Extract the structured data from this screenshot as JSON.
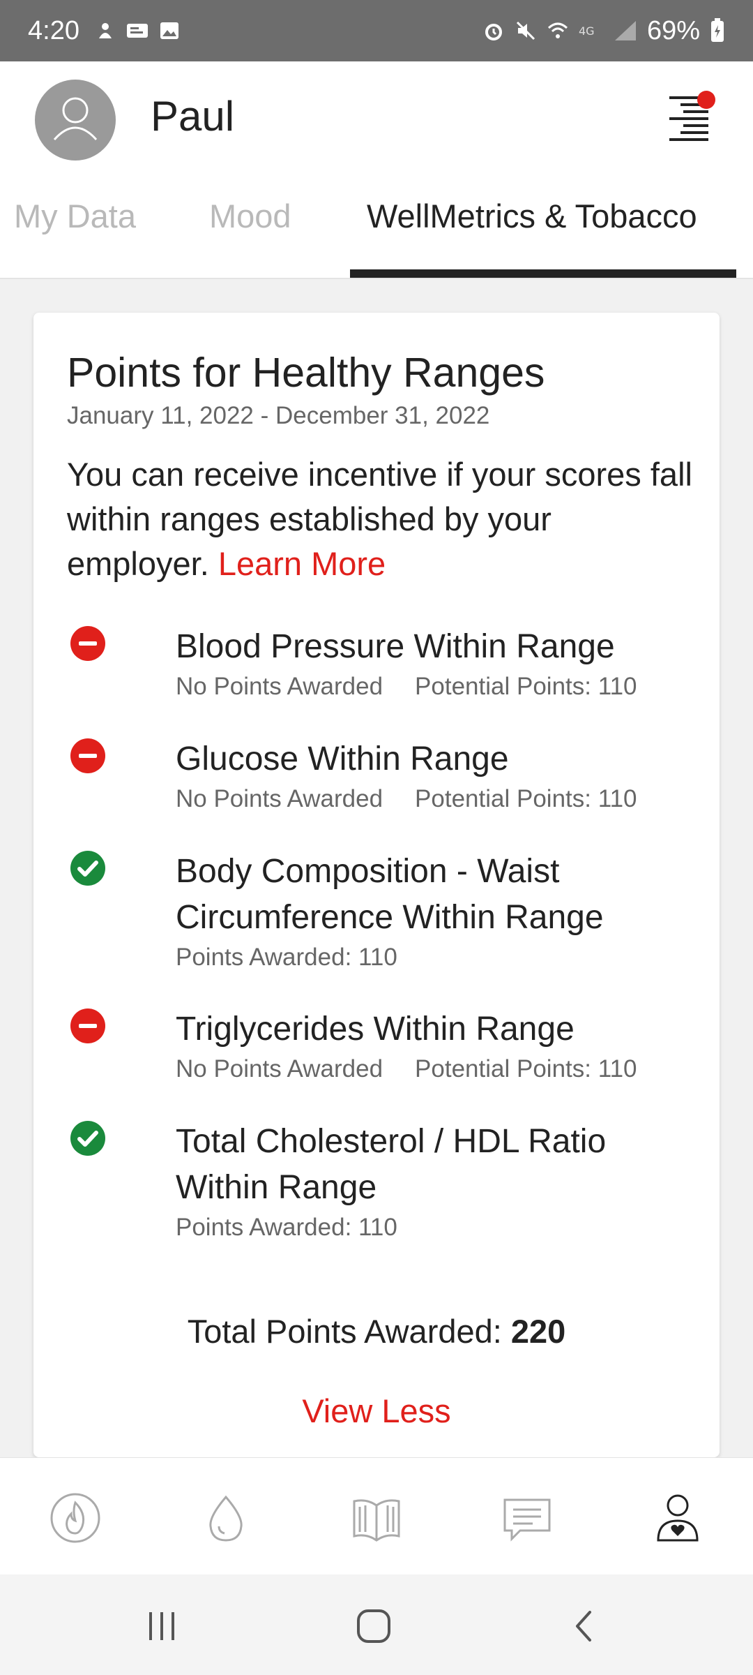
{
  "status_bar": {
    "time": "4:20",
    "left_icons": [
      "notification-icon",
      "message-icon",
      "image-icon"
    ],
    "right_icons": [
      "alarm-icon",
      "mute-icon",
      "wifi-icon",
      "4g-icon",
      "signal-icon"
    ],
    "battery": "69%"
  },
  "header": {
    "username": "Paul",
    "menu_has_notification": true
  },
  "tabs": [
    {
      "label": "My Data",
      "active": false
    },
    {
      "label": "Mood",
      "active": false
    },
    {
      "label": "WellMetrics & Tobacco",
      "active": true
    }
  ],
  "card": {
    "title": "Points for Healthy Ranges",
    "date_range": "January 11, 2022 - December 31, 2022",
    "description": "You can receive incentive if your scores fall within ranges established by your employer.",
    "learn_more": "Learn More",
    "metrics": [
      {
        "title": "Blood Pressure Within Range",
        "status": "not-met",
        "awarded": "No Points Awarded",
        "potential": "Potential Points: 110"
      },
      {
        "title": "Glucose Within Range",
        "status": "not-met",
        "awarded": "No Points Awarded",
        "potential": "Potential Points: 110"
      },
      {
        "title": "Body Composition - Waist Circumference Within Range",
        "status": "met",
        "awarded": "Points Awarded: 110",
        "potential": ""
      },
      {
        "title": "Triglycerides Within Range",
        "status": "not-met",
        "awarded": "No Points Awarded",
        "potential": "Potential Points: 110"
      },
      {
        "title": "Total Cholesterol / HDL Ratio Within Range",
        "status": "met",
        "awarded": "Points Awarded: 110",
        "potential": ""
      }
    ],
    "total_label": "Total Points Awarded:",
    "total_value": "220",
    "view_less": "View Less"
  },
  "bottom_nav": [
    "flame-icon",
    "droplet-icon",
    "book-icon",
    "chat-icon",
    "profile-heart-icon"
  ],
  "system_nav": [
    "recent-apps-icon",
    "home-icon",
    "back-icon"
  ],
  "colors": {
    "accent_red": "#e0201b",
    "success_green": "#1a8a3c",
    "status_bar": "#6d6d6d"
  }
}
